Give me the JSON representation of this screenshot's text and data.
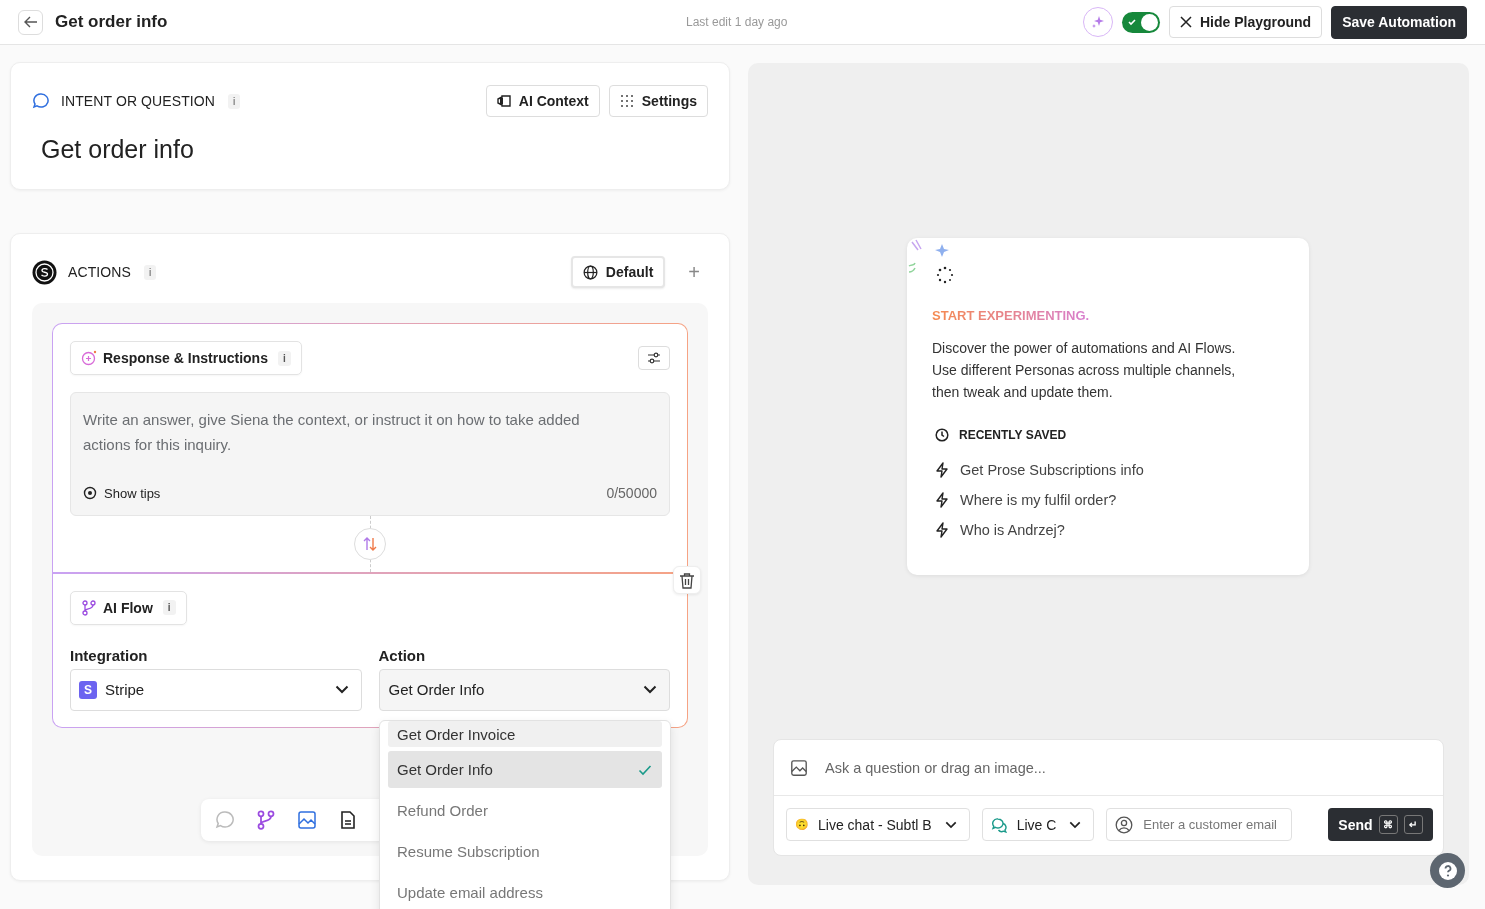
{
  "header": {
    "title": "Get order info",
    "last_edit": "Last edit 1 day ago",
    "toggle_on": true,
    "hide_button": "Hide Playground",
    "save_button": "Save Automation"
  },
  "intent": {
    "label": "INTENT OR QUESTION",
    "info": "i",
    "buttons": [
      "AI Context",
      "Settings"
    ],
    "question": "Get order info"
  },
  "actions": {
    "label": "ACTIONS",
    "info": "i",
    "default_button": "Default",
    "add": "+"
  },
  "response": {
    "label": "Response & Instructions",
    "info": "i",
    "placeholder": "Write an answer, give Siena the context, or instruct it on how to take added actions for this inquiry.",
    "show_tips": "Show tips",
    "counter": "0/50000"
  },
  "ai_flow": {
    "label": "AI Flow",
    "info": "i",
    "integration": {
      "label": "Integration",
      "value": "Stripe",
      "logo": "S"
    },
    "action": {
      "label": "Action",
      "value": "Get Order Info"
    },
    "options": [
      {
        "label": "Get Order Invoice",
        "selected": false,
        "hovered": true
      },
      {
        "label": "Get Order Info",
        "selected": true,
        "hovered": false
      },
      {
        "label": "Refund Order",
        "selected": false,
        "hovered": false
      },
      {
        "label": "Resume Subscription",
        "selected": false,
        "hovered": false
      },
      {
        "label": "Update email address",
        "selected": false,
        "hovered": false
      }
    ]
  },
  "playground": {
    "heading": "START EXPERIMENTING.",
    "body": "Discover the power of automations and AI Flows. Use different Personas across multiple channels, then tweak and update them.",
    "recent_label": "RECENTLY SAVED",
    "recent": [
      "Get Prose Subscriptions info",
      "Where is my fulfil order?",
      "Who is Andrzej?"
    ]
  },
  "composer": {
    "placeholder": "Ask a question or drag an image...",
    "persona_emoji": "🙃",
    "persona": "Live chat - Subtl B",
    "channel": "Live C",
    "email_placeholder": "Enter a customer email",
    "send": "Send",
    "keys": [
      "⌘",
      "↵"
    ]
  }
}
